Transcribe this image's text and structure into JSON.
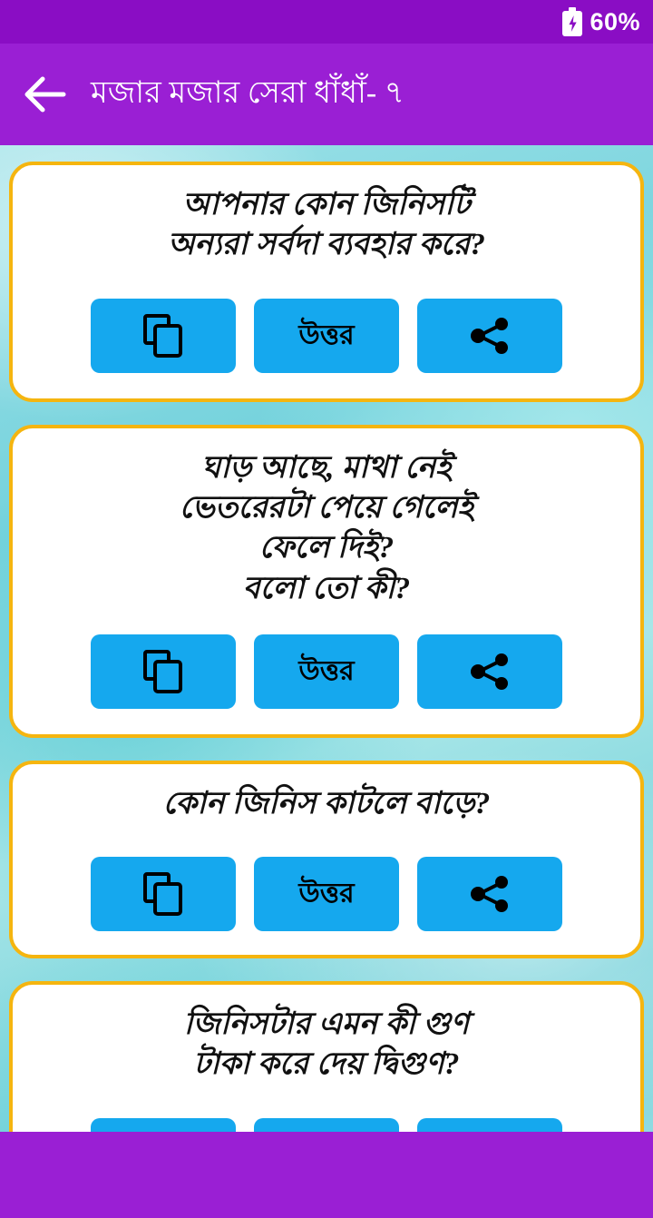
{
  "status_bar": {
    "battery_percent": "60%",
    "battery_icon": "battery-charging-icon",
    "background_color": "#8A0DC4"
  },
  "app_bar": {
    "back_icon": "back-arrow-icon",
    "title": "মজার মজার সেরা ধাঁধাঁ- ৭",
    "background_color": "#9A1FD4"
  },
  "theme": {
    "card_border_color": "#F5B50F",
    "card_background": "#FFFFFF",
    "button_color": "#15A8EE",
    "page_background": "#74D2DC"
  },
  "buttons": {
    "copy_icon": "copy-icon",
    "answer_label": "উত্তর",
    "share_icon": "share-icon"
  },
  "cards": [
    {
      "lines": [
        "আপনার কোন জিনিসটি",
        "অন্যরা সর্বদা ব্যবহার করে?"
      ]
    },
    {
      "lines": [
        "ঘাড় আছে, মাথা নেই",
        "ভেতরেরটা পেয়ে গেলেই",
        "ফেলে দিই?",
        "বলো তো কী?"
      ]
    },
    {
      "lines": [
        "কোন জিনিস কাটলে বাড়ে?"
      ]
    },
    {
      "lines": [
        "জিনিসটার এমন কী গুণ",
        "টাকা করে দেয় দ্বিগুণ?"
      ]
    }
  ]
}
